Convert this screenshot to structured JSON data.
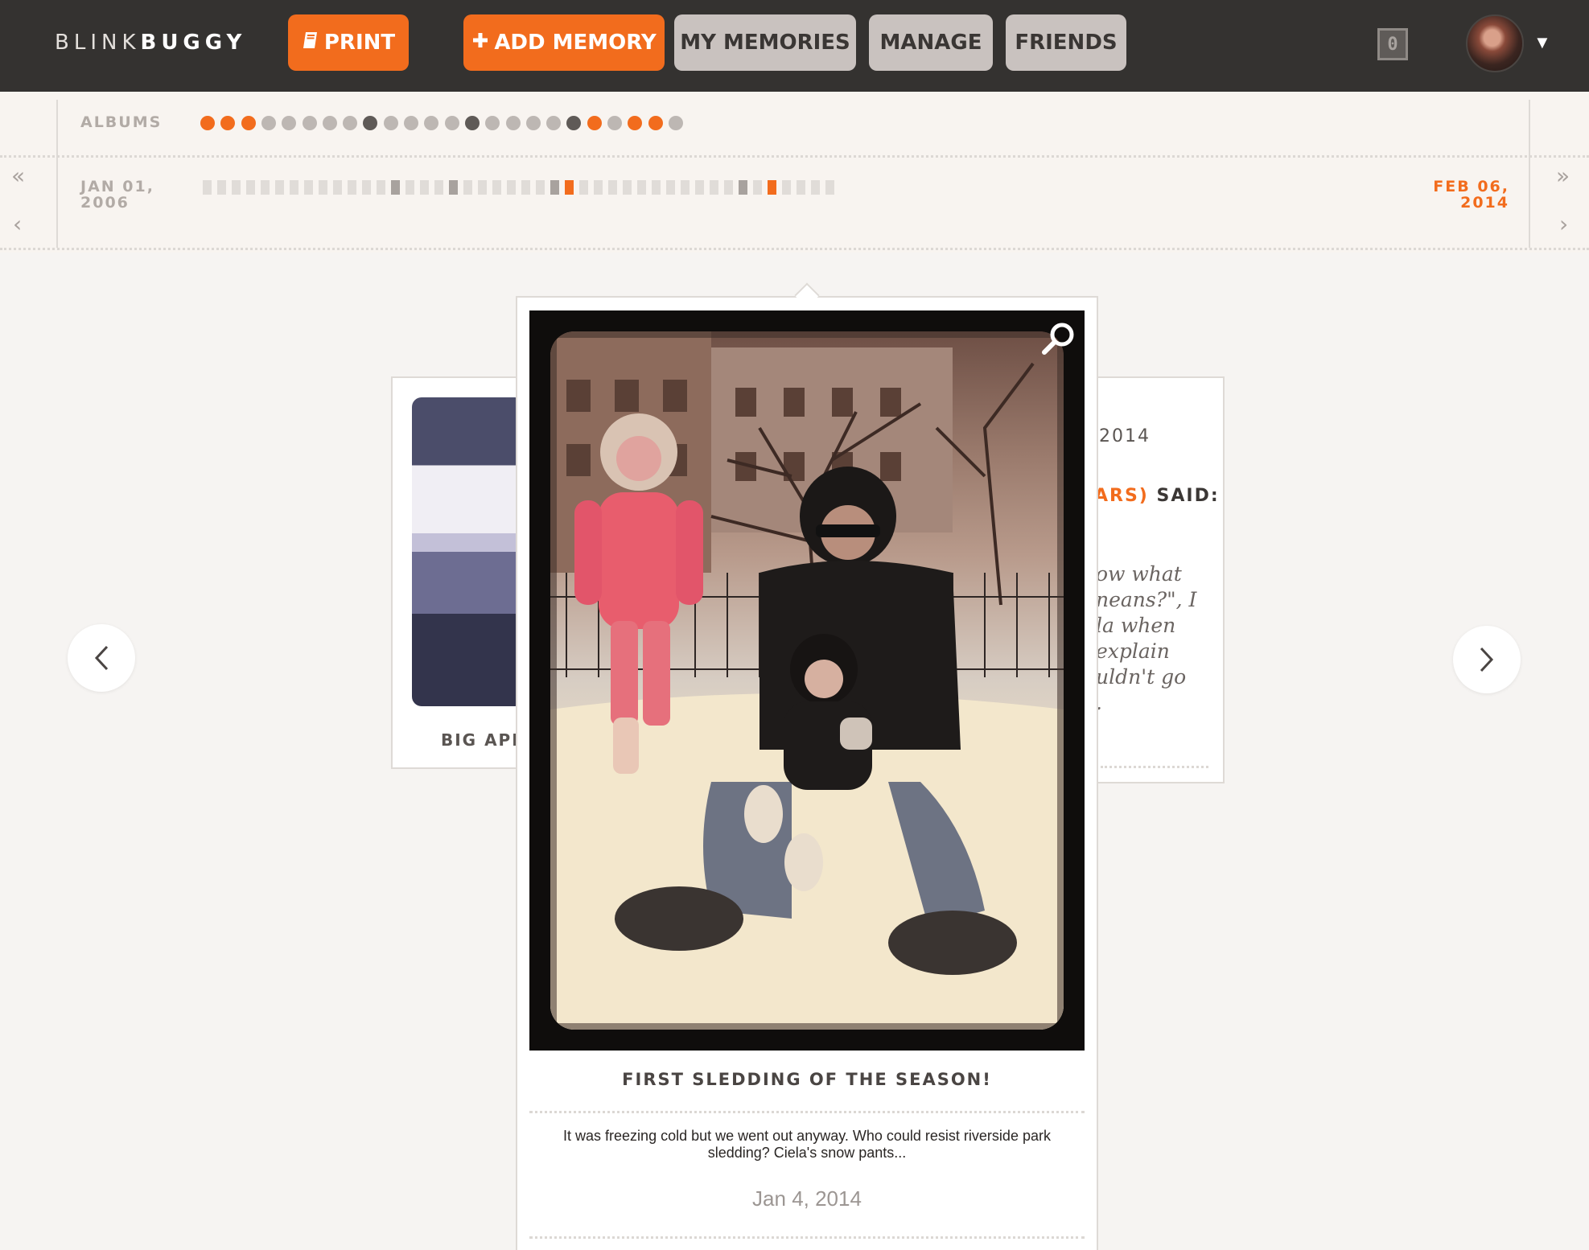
{
  "brand": {
    "light": "BLINK",
    "bold": "BUGGY"
  },
  "nav": {
    "print": "PRINT",
    "add_memory": "ADD MEMORY",
    "my_memories": "MY MEMORIES",
    "manage": "MANAGE",
    "friends": "FRIENDS"
  },
  "notification_count": "0",
  "timeline": {
    "albums_label": "ALBUMS",
    "start_date_line1": "JAN 01,",
    "start_date_line2": "2006",
    "end_date_line1": "FEB 06,",
    "end_date_line2": "2014",
    "album_dots": [
      "orange",
      "orange",
      "orange",
      "light",
      "light",
      "light",
      "light",
      "light",
      "dark",
      "light",
      "light",
      "light",
      "light",
      "dark",
      "light",
      "light",
      "light",
      "light",
      "dark",
      "orange",
      "light",
      "orange",
      "orange",
      "light"
    ]
  },
  "left_card": {
    "caption": "BIG APP"
  },
  "right_card": {
    "date_fragment": "2014",
    "author_fragment": "ARS)",
    "said": "SAID:",
    "lines": [
      "ow what",
      "neans?\", I",
      "la when",
      "explain",
      "uldn't go",
      "."
    ]
  },
  "main_card": {
    "title": "FIRST SLEDDING OF THE SEASON!",
    "description": "It was freezing cold but we went out anyway. Who could resist riverside park sledding? Ciela's snow pants...",
    "date": "Jan 4, 2014"
  },
  "colors": {
    "accent": "#f26c1d",
    "topbar": "#343230",
    "button_gray": "#c9c2bf"
  },
  "icons": [
    "book-icon",
    "plus-icon",
    "chevron-left-icon",
    "chevron-right-icon",
    "double-chevron-left-icon",
    "double-chevron-right-icon",
    "magnifier-icon",
    "caret-down-icon"
  ]
}
